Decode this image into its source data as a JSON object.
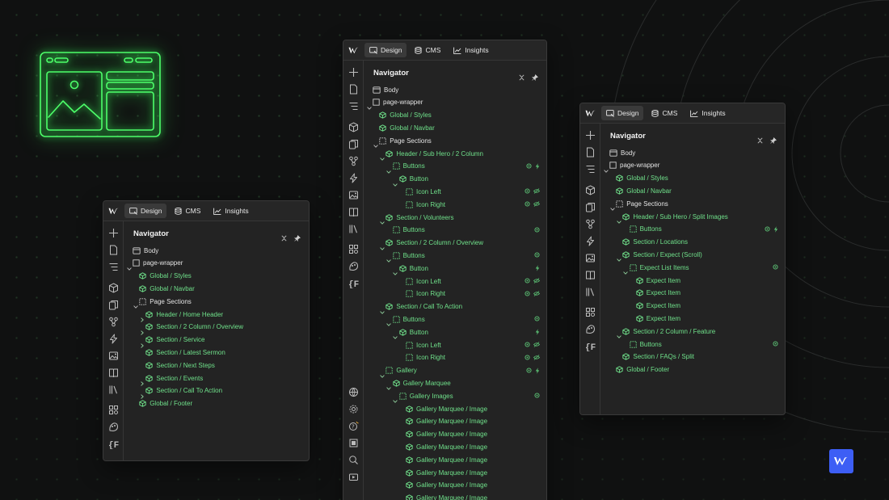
{
  "colors": {
    "background": "#101111",
    "panel": "#232323",
    "green_label": "#6fe08a",
    "white_label": "#e3e3e3",
    "neon": "#39ff5a",
    "brand_blue": "#3d5ef5"
  },
  "tabs": {
    "design": "Design",
    "cms": "CMS",
    "insights": "Insights"
  },
  "navigator_title": "Navigator",
  "panels": [
    {
      "id": "left",
      "rows": [
        {
          "label": "Body",
          "depth": 0,
          "icon": "body",
          "chev": "",
          "color": "w"
        },
        {
          "label": "page-wrapper",
          "depth": 0,
          "icon": "box",
          "chev": "down",
          "color": "w"
        },
        {
          "label": "Global / Styles",
          "depth": 1,
          "icon": "component",
          "chev": "",
          "color": "g"
        },
        {
          "label": "Global / Navbar",
          "depth": 1,
          "icon": "component",
          "chev": "",
          "color": "g"
        },
        {
          "label": "Page Sections",
          "depth": 1,
          "icon": "dashed",
          "chev": "down",
          "color": "w"
        },
        {
          "label": "Header / Home Header",
          "depth": 2,
          "icon": "component",
          "chev": "right",
          "color": "g"
        },
        {
          "label": "Section / 2 Column / Overview",
          "depth": 2,
          "icon": "component",
          "chev": "right",
          "color": "g"
        },
        {
          "label": "Section / Service",
          "depth": 2,
          "icon": "component",
          "chev": "right",
          "color": "g"
        },
        {
          "label": "Section / Latest Sermon",
          "depth": 2,
          "icon": "component",
          "chev": "",
          "color": "g"
        },
        {
          "label": "Section / Next Steps",
          "depth": 2,
          "icon": "component",
          "chev": "",
          "color": "g"
        },
        {
          "label": "Section / Events",
          "depth": 2,
          "icon": "component",
          "chev": "right",
          "color": "g"
        },
        {
          "label": "Section / Call To Action",
          "depth": 2,
          "icon": "component",
          "chev": "right",
          "color": "g"
        },
        {
          "label": "Global / Footer",
          "depth": 1,
          "icon": "component",
          "chev": "",
          "color": "g"
        }
      ]
    },
    {
      "id": "middle",
      "rows": [
        {
          "label": "Body",
          "depth": 0,
          "icon": "body",
          "chev": "",
          "color": "w"
        },
        {
          "label": "page-wrapper",
          "depth": 0,
          "icon": "box",
          "chev": "down",
          "color": "w"
        },
        {
          "label": "Global / Styles",
          "depth": 1,
          "icon": "component",
          "chev": "",
          "color": "g"
        },
        {
          "label": "Global / Navbar",
          "depth": 1,
          "icon": "component",
          "chev": "",
          "color": "g"
        },
        {
          "label": "Page Sections",
          "depth": 1,
          "icon": "dashed",
          "chev": "down",
          "color": "w"
        },
        {
          "label": "Header / Sub Hero / 2 Column",
          "depth": 2,
          "icon": "component",
          "chev": "down",
          "color": "g"
        },
        {
          "label": "Buttons",
          "depth": 3,
          "icon": "dashed",
          "chev": "down",
          "color": "g",
          "right": [
            "dot",
            "bolt"
          ]
        },
        {
          "label": "Button",
          "depth": 4,
          "icon": "component",
          "chev": "down",
          "color": "g"
        },
        {
          "label": "Icon Left",
          "depth": 5,
          "icon": "dashed",
          "chev": "",
          "color": "g",
          "right": [
            "dot",
            "hide"
          ]
        },
        {
          "label": "Icon Right",
          "depth": 5,
          "icon": "dashed",
          "chev": "",
          "color": "g",
          "right": [
            "dot",
            "hide"
          ]
        },
        {
          "label": "Section / Volunteers",
          "depth": 2,
          "icon": "component",
          "chev": "down",
          "color": "g"
        },
        {
          "label": "Buttons",
          "depth": 3,
          "icon": "dashed",
          "chev": "",
          "color": "g",
          "right": [
            "dot"
          ]
        },
        {
          "label": "Section / 2 Column / Overview",
          "depth": 2,
          "icon": "component",
          "chev": "down",
          "color": "g"
        },
        {
          "label": "Buttons",
          "depth": 3,
          "icon": "dashed",
          "chev": "down",
          "color": "g",
          "right": [
            "dot"
          ]
        },
        {
          "label": "Button",
          "depth": 4,
          "icon": "component",
          "chev": "down",
          "color": "g",
          "right": [
            "bolt"
          ]
        },
        {
          "label": "Icon Left",
          "depth": 5,
          "icon": "dashed",
          "chev": "",
          "color": "g",
          "right": [
            "dot",
            "hide"
          ]
        },
        {
          "label": "Icon Right",
          "depth": 5,
          "icon": "dashed",
          "chev": "",
          "color": "g",
          "right": [
            "dot",
            "hide"
          ]
        },
        {
          "label": "Section / Call To Action",
          "depth": 2,
          "icon": "component",
          "chev": "down",
          "color": "g"
        },
        {
          "label": "Buttons",
          "depth": 3,
          "icon": "dashed",
          "chev": "down",
          "color": "g",
          "right": [
            "dot"
          ]
        },
        {
          "label": "Button",
          "depth": 4,
          "icon": "component",
          "chev": "down",
          "color": "g",
          "right": [
            "bolt"
          ]
        },
        {
          "label": "Icon Left",
          "depth": 5,
          "icon": "dashed",
          "chev": "",
          "color": "g",
          "right": [
            "dot",
            "hide"
          ]
        },
        {
          "label": "Icon Right",
          "depth": 5,
          "icon": "dashed",
          "chev": "",
          "color": "g",
          "right": [
            "dot",
            "hide"
          ]
        },
        {
          "label": "Gallery",
          "depth": 2,
          "icon": "dashed",
          "chev": "down",
          "color": "g",
          "right": [
            "dot",
            "bolt"
          ]
        },
        {
          "label": "Gallery Marquee",
          "depth": 3,
          "icon": "component",
          "chev": "down",
          "color": "g"
        },
        {
          "label": "Gallery Images",
          "depth": 4,
          "icon": "dashed",
          "chev": "down",
          "color": "g",
          "right": [
            "dot"
          ]
        },
        {
          "label": "Gallery Marquee / Image",
          "depth": 5,
          "icon": "component",
          "chev": "",
          "color": "g"
        },
        {
          "label": "Gallery Marquee / Image",
          "depth": 5,
          "icon": "component",
          "chev": "",
          "color": "g"
        },
        {
          "label": "Gallery Marquee / Image",
          "depth": 5,
          "icon": "component",
          "chev": "",
          "color": "g"
        },
        {
          "label": "Gallery Marquee / Image",
          "depth": 5,
          "icon": "component",
          "chev": "",
          "color": "g"
        },
        {
          "label": "Gallery Marquee / Image",
          "depth": 5,
          "icon": "component",
          "chev": "",
          "color": "g"
        },
        {
          "label": "Gallery Marquee / Image",
          "depth": 5,
          "icon": "component",
          "chev": "",
          "color": "g"
        },
        {
          "label": "Gallery Marquee / Image",
          "depth": 5,
          "icon": "component",
          "chev": "",
          "color": "g"
        },
        {
          "label": "Gallery Marquee / Image",
          "depth": 5,
          "icon": "component",
          "chev": "",
          "color": "g"
        }
      ]
    },
    {
      "id": "right",
      "rows": [
        {
          "label": "Body",
          "depth": 0,
          "icon": "body",
          "chev": "",
          "color": "w"
        },
        {
          "label": "page-wrapper",
          "depth": 0,
          "icon": "box",
          "chev": "down",
          "color": "w"
        },
        {
          "label": "Global / Styles",
          "depth": 1,
          "icon": "component",
          "chev": "",
          "color": "g"
        },
        {
          "label": "Global / Navbar",
          "depth": 1,
          "icon": "component",
          "chev": "",
          "color": "g"
        },
        {
          "label": "Page Sections",
          "depth": 1,
          "icon": "dashed",
          "chev": "down",
          "color": "w"
        },
        {
          "label": "Header / Sub Hero / Split Images",
          "depth": 2,
          "icon": "component",
          "chev": "down",
          "color": "g"
        },
        {
          "label": "Buttons",
          "depth": 3,
          "icon": "dashed",
          "chev": "",
          "color": "g",
          "right": [
            "dot",
            "bolt"
          ]
        },
        {
          "label": "Section / Locations",
          "depth": 2,
          "icon": "component",
          "chev": "",
          "color": "g"
        },
        {
          "label": "Section / Expect (Scroll)",
          "depth": 2,
          "icon": "component",
          "chev": "down",
          "color": "g"
        },
        {
          "label": "Expect List Items",
          "depth": 3,
          "icon": "dashed",
          "chev": "down",
          "color": "g",
          "right": [
            "dot"
          ]
        },
        {
          "label": "Expect Item",
          "depth": 4,
          "icon": "component",
          "chev": "",
          "color": "g"
        },
        {
          "label": "Expect Item",
          "depth": 4,
          "icon": "component",
          "chev": "",
          "color": "g"
        },
        {
          "label": "Expect Item",
          "depth": 4,
          "icon": "component",
          "chev": "",
          "color": "g"
        },
        {
          "label": "Expect Item",
          "depth": 4,
          "icon": "component",
          "chev": "",
          "color": "g"
        },
        {
          "label": "Section / 2 Column / Feature",
          "depth": 2,
          "icon": "component",
          "chev": "down",
          "color": "g"
        },
        {
          "label": "Buttons",
          "depth": 3,
          "icon": "dashed",
          "chev": "",
          "color": "g",
          "right": [
            "dot"
          ]
        },
        {
          "label": "Section / FAQs / Split",
          "depth": 2,
          "icon": "component",
          "chev": "",
          "color": "g"
        },
        {
          "label": "Global / Footer",
          "depth": 1,
          "icon": "component",
          "chev": "",
          "color": "g"
        }
      ]
    }
  ]
}
